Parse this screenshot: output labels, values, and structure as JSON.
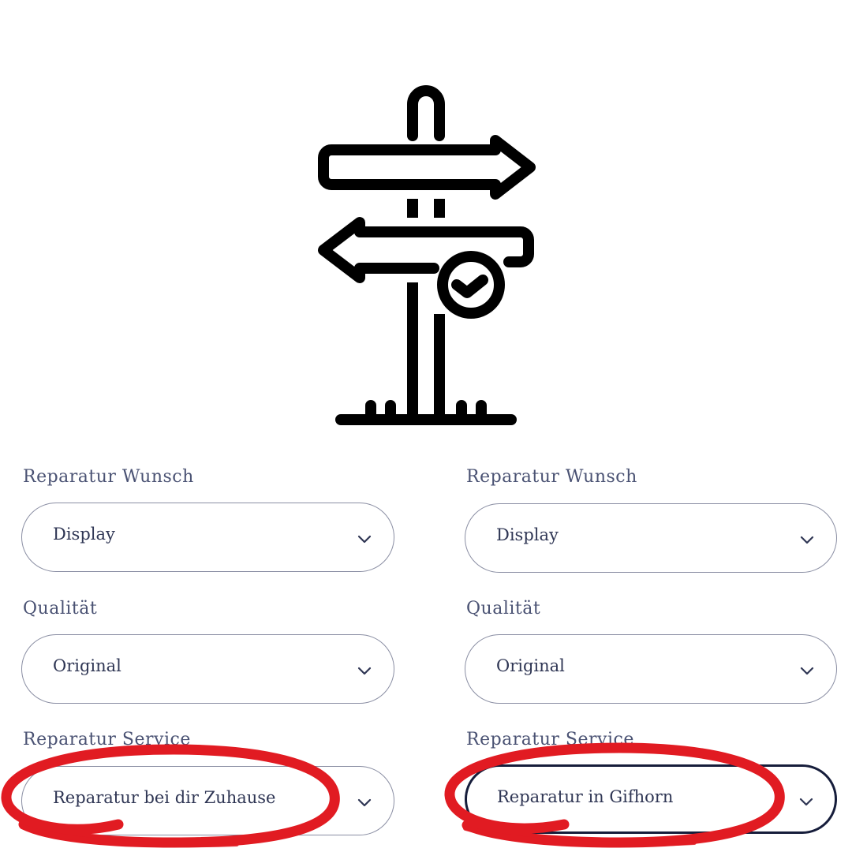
{
  "colors": {
    "label": "#4a5273",
    "value": "#2f3654",
    "border": "#8a8ea3",
    "focused_border": "#161d3b",
    "annotation": "#e11b22",
    "icon": "#000000"
  },
  "icons": {
    "hero": "signpost-check-icon",
    "dropdown": "chevron-down-icon"
  },
  "columns": [
    {
      "fields": [
        {
          "label": "Reparatur Wunsch",
          "value": "Display"
        },
        {
          "label": "Qualität",
          "value": "Original"
        },
        {
          "label": "Reparatur Service",
          "value": "Reparatur bei dir Zuhause"
        }
      ]
    },
    {
      "fields": [
        {
          "label": "Reparatur Wunsch",
          "value": "Display"
        },
        {
          "label": "Qualität",
          "value": "Original"
        },
        {
          "label": "Reparatur Service",
          "value": "Reparatur in Gifhorn",
          "focused": true
        }
      ]
    }
  ]
}
